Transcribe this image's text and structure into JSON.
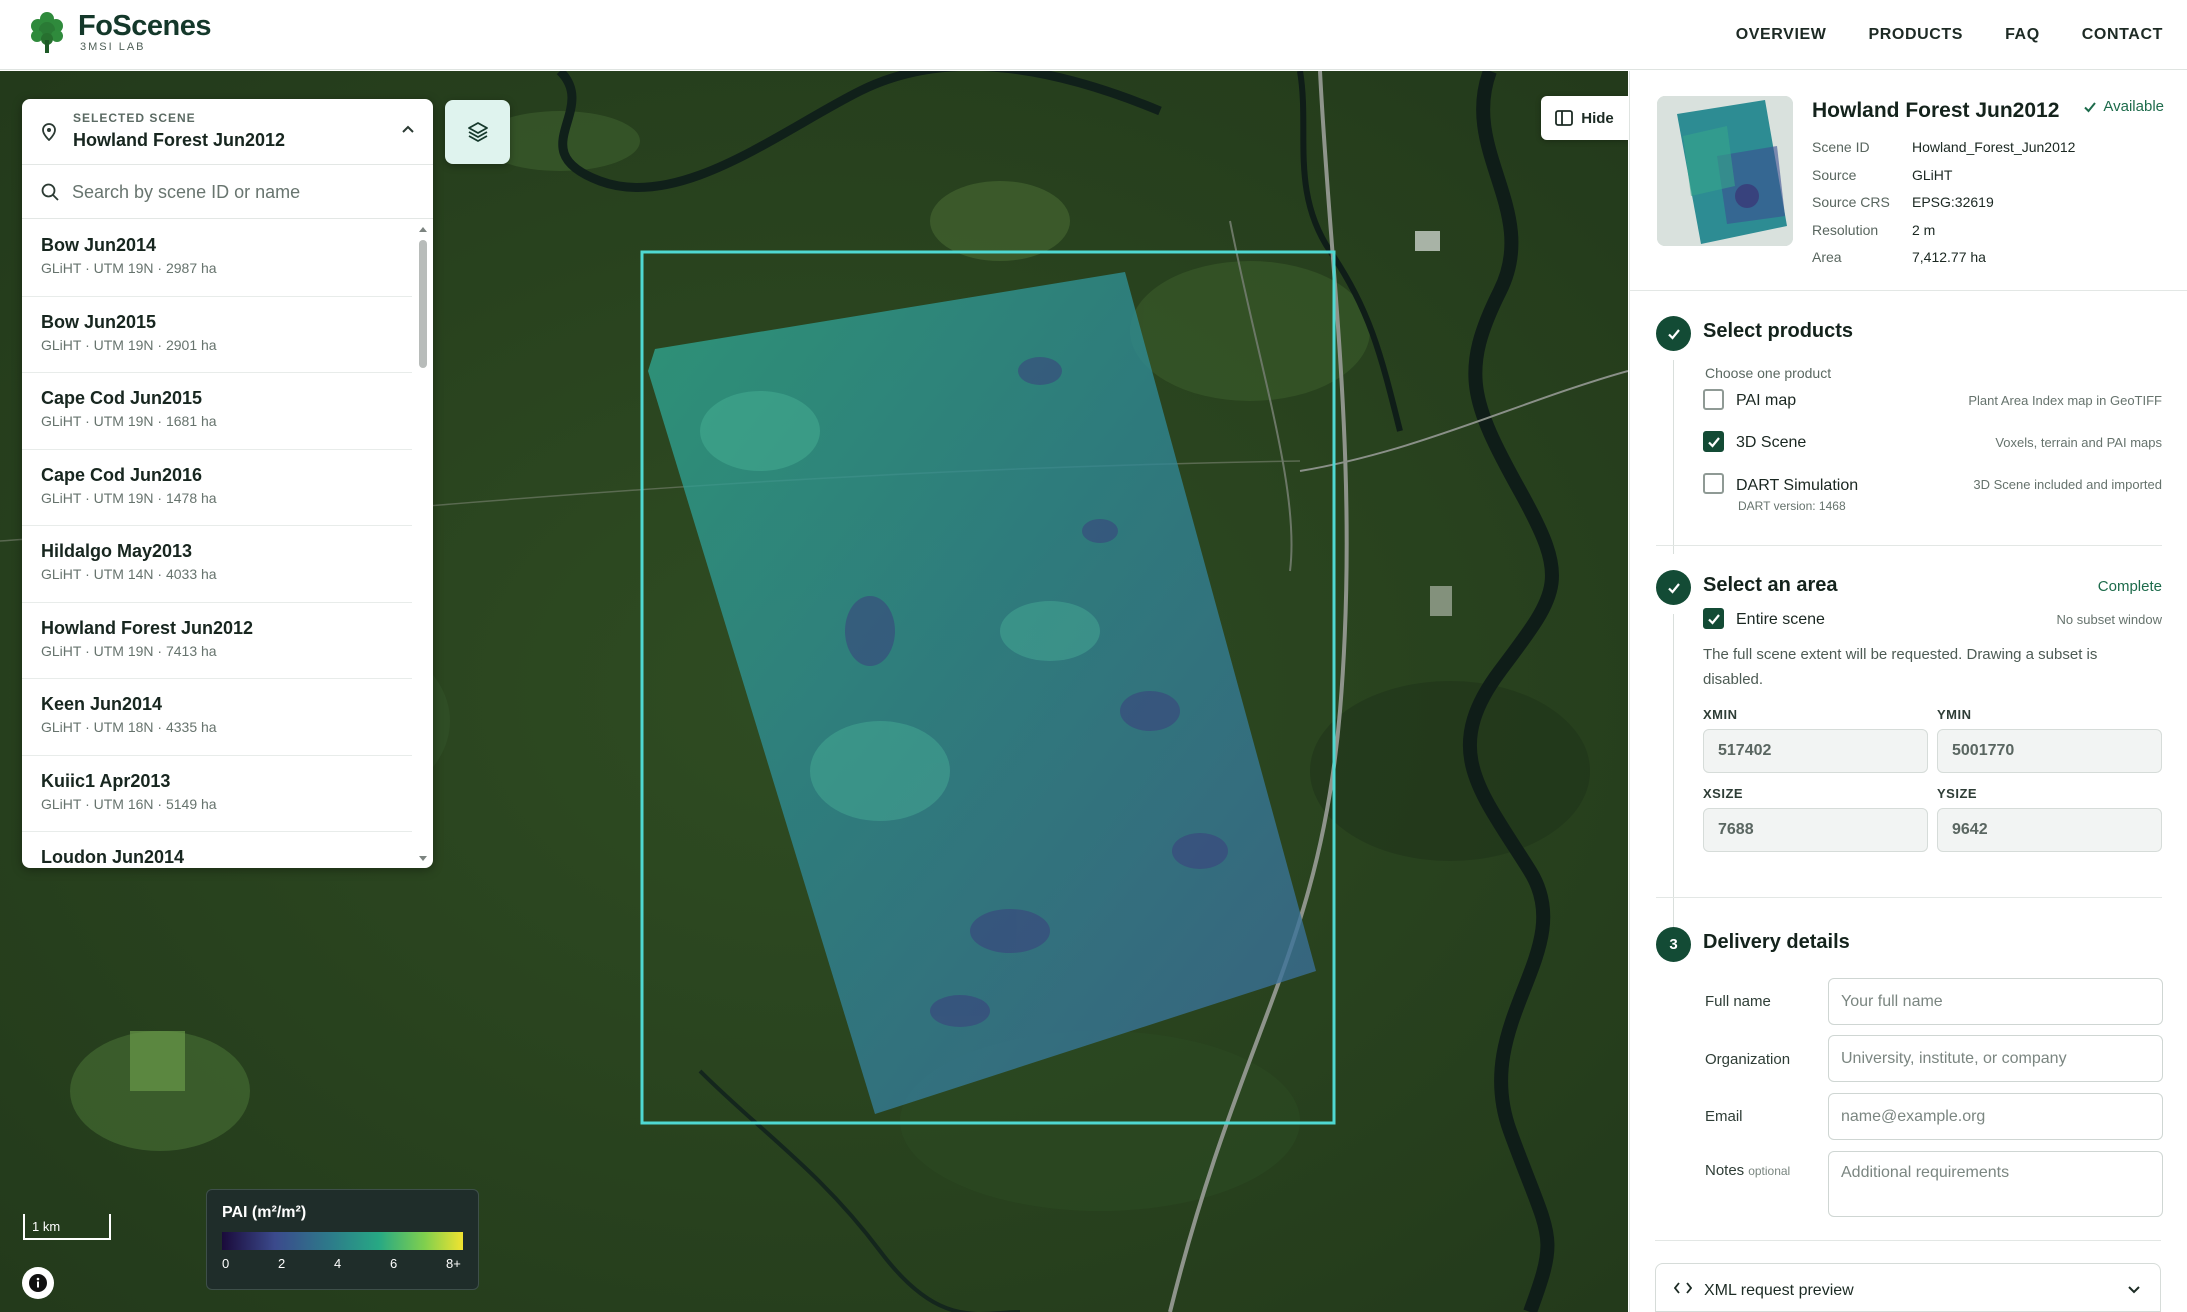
{
  "brand": {
    "title": "FoScenes",
    "subtitle": "3MSI LAB"
  },
  "nav": [
    "OVERVIEW",
    "PRODUCTS",
    "FAQ",
    "CONTACT"
  ],
  "scene_picker": {
    "label": "SELECTED SCENE",
    "selected": "Howland Forest Jun2012",
    "search_placeholder": "Search by scene ID or name",
    "items": [
      {
        "name": "Bow Jun2014",
        "meta": "GLiHT · UTM 19N · 2987 ha"
      },
      {
        "name": "Bow Jun2015",
        "meta": "GLiHT · UTM 19N · 2901 ha"
      },
      {
        "name": "Cape Cod Jun2015",
        "meta": "GLiHT · UTM 19N · 1681 ha"
      },
      {
        "name": "Cape Cod Jun2016",
        "meta": "GLiHT · UTM 19N · 1478 ha"
      },
      {
        "name": "Hildalgo May2013",
        "meta": "GLiHT · UTM 14N · 4033 ha"
      },
      {
        "name": "Howland Forest Jun2012",
        "meta": "GLiHT · UTM 19N · 7413 ha"
      },
      {
        "name": "Keen Jun2014",
        "meta": "GLiHT · UTM 18N · 4335 ha"
      },
      {
        "name": "Kuiic1 Apr2013",
        "meta": "GLiHT · UTM 16N · 5149 ha"
      },
      {
        "name": "Loudon Jun2014",
        "meta": ""
      }
    ]
  },
  "map": {
    "hide_label": "Hide",
    "scale_label": "1 km",
    "legend": {
      "title": "PAI (m²/m²)",
      "ticks": [
        "0",
        "2",
        "4",
        "6",
        "8+"
      ]
    },
    "colors": {
      "selection": "#4fd8d2",
      "legend_low": "#1a0a3a",
      "legend_high": "#f1e330"
    }
  },
  "summary": {
    "title": "Howland Forest Jun2012",
    "status": "Available",
    "rows": [
      {
        "k": "Scene ID",
        "v": "Howland_Forest_Jun2012"
      },
      {
        "k": "Source",
        "v": "GLiHT"
      },
      {
        "k": "Source CRS",
        "v": "EPSG:32619"
      },
      {
        "k": "Resolution",
        "v": "2 m"
      },
      {
        "k": "Area",
        "v": "7,412.77 ha"
      }
    ]
  },
  "products": {
    "title": "Select products",
    "hint": "Choose one product",
    "options": [
      {
        "label": "PAI map",
        "desc": "Plant Area Index map in GeoTIFF",
        "checked": false
      },
      {
        "label": "3D Scene",
        "desc": "Voxels, terrain and PAI maps",
        "checked": true
      },
      {
        "label": "DART Simulation",
        "desc": "3D Scene included and imported",
        "sub": "DART version: 1468",
        "checked": false
      }
    ]
  },
  "area": {
    "title": "Select an area",
    "status": "Complete",
    "entire_label": "Entire scene",
    "entire_desc": "No subset window",
    "note": "The full scene extent will be requested. Drawing a subset is disabled.",
    "fields": {
      "xmin_label": "XMIN",
      "xmin": "517402",
      "ymin_label": "YMIN",
      "ymin": "5001770",
      "xsize_label": "XSIZE",
      "xsize": "7688",
      "ysize_label": "YSIZE",
      "ysize": "9642"
    }
  },
  "delivery": {
    "step": "3",
    "title": "Delivery details",
    "name_label": "Full name",
    "name_ph": "Your full name",
    "org_label": "Organization",
    "org_ph": "University, institute, or company",
    "email_label": "Email",
    "email_ph": "name@example.org",
    "notes_label": "Notes",
    "notes_opt": "optional",
    "notes_ph": "Additional requirements"
  },
  "xml": {
    "label": "XML request preview"
  },
  "icons": [
    "tree-logo-icon",
    "pin-icon",
    "chevron-up-icon",
    "search-icon",
    "layers-icon",
    "sidebar-icon",
    "info-icon",
    "check-icon",
    "code-icon",
    "chevron-down-icon"
  ]
}
